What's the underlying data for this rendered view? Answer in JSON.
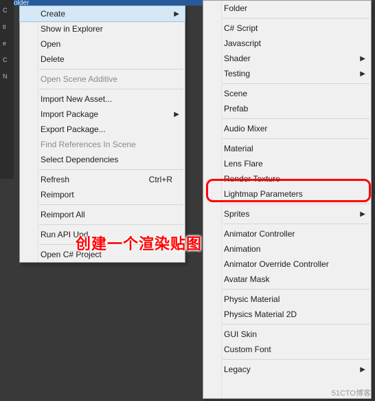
{
  "titlebar": {
    "text": "w Folder"
  },
  "sidebar": {
    "rows": [
      "C",
      "ti",
      "e",
      "C",
      "N"
    ]
  },
  "menu_left": {
    "groups": [
      [
        {
          "label": "Create",
          "arrow": true,
          "hover": true
        },
        {
          "label": "Show in Explorer"
        },
        {
          "label": "Open"
        },
        {
          "label": "Delete"
        }
      ],
      [
        {
          "label": "Open Scene Additive",
          "disabled": true
        }
      ],
      [
        {
          "label": "Import New Asset..."
        },
        {
          "label": "Import Package",
          "arrow": true
        },
        {
          "label": "Export Package..."
        },
        {
          "label": "Find References In Scene",
          "disabled": true
        },
        {
          "label": "Select Dependencies"
        }
      ],
      [
        {
          "label": "Refresh",
          "shortcut": "Ctrl+R"
        },
        {
          "label": "Reimport"
        }
      ],
      [
        {
          "label": "Reimport All"
        }
      ],
      [
        {
          "label": "Run API Upd"
        }
      ],
      [
        {
          "label": "Open C# Project"
        }
      ]
    ]
  },
  "menu_right": {
    "groups": [
      [
        {
          "label": "Folder"
        }
      ],
      [
        {
          "label": "C# Script"
        },
        {
          "label": "Javascript"
        },
        {
          "label": "Shader",
          "arrow": true
        },
        {
          "label": "Testing",
          "arrow": true
        }
      ],
      [
        {
          "label": "Scene"
        },
        {
          "label": "Prefab"
        }
      ],
      [
        {
          "label": "Audio Mixer"
        }
      ],
      [
        {
          "label": "Material"
        },
        {
          "label": "Lens Flare"
        },
        {
          "label": "Render Texture",
          "highlight": true
        },
        {
          "label": "Lightmap Parameters"
        }
      ],
      [
        {
          "label": "Sprites",
          "arrow": true
        }
      ],
      [
        {
          "label": "Animator Controller"
        },
        {
          "label": "Animation"
        },
        {
          "label": "Animator Override Controller"
        },
        {
          "label": "Avatar Mask"
        }
      ],
      [
        {
          "label": "Physic Material"
        },
        {
          "label": "Physics Material 2D"
        }
      ],
      [
        {
          "label": "GUI Skin"
        },
        {
          "label": "Custom Font"
        }
      ],
      [
        {
          "label": "Legacy",
          "arrow": true
        }
      ]
    ]
  },
  "annotation": {
    "text": "创建一个渲染贴图"
  },
  "watermark": {
    "text": "51CTO博客"
  }
}
